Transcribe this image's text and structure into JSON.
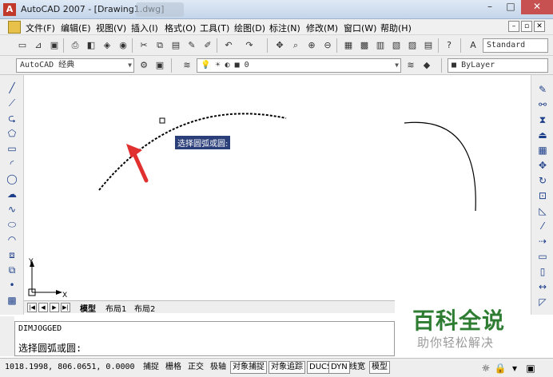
{
  "window": {
    "title": "AutoCAD 2007 - [Drawing1.dwg]",
    "controls": {
      "minimize": "–",
      "maximize": "□",
      "close": "✕"
    }
  },
  "menubar": {
    "items": [
      {
        "label": "文件(F)"
      },
      {
        "label": "编辑(E)"
      },
      {
        "label": "视图(V)"
      },
      {
        "label": "插入(I)"
      },
      {
        "label": "格式(O)"
      },
      {
        "label": "工具(T)"
      },
      {
        "label": "绘图(D)"
      },
      {
        "label": "标注(N)"
      },
      {
        "label": "修改(M)"
      },
      {
        "label": "窗口(W)"
      },
      {
        "label": "帮助(H)"
      }
    ],
    "mdi": {
      "minimize": "–",
      "restore": "▫",
      "close": "✕"
    }
  },
  "toolbar": {
    "text_style": "Standard",
    "workspace": "AutoCAD 经典",
    "layer": "0",
    "color": "ByLayer"
  },
  "canvas": {
    "tooltip": "选择圆弧或圆:",
    "ucs": {
      "x": "X",
      "y": "Y"
    }
  },
  "tabs": {
    "model": "模型",
    "layout1": "布局1",
    "layout2": "布局2"
  },
  "command": {
    "history": "DIMJOGGED",
    "prompt": "选择圆弧或圆:"
  },
  "statusbar": {
    "coords": "1018.1998, 806.0651, 0.0000",
    "toggles": [
      {
        "label": "捕捉",
        "on": false
      },
      {
        "label": "栅格",
        "on": false
      },
      {
        "label": "正交",
        "on": false
      },
      {
        "label": "极轴",
        "on": false
      },
      {
        "label": "对象捕捉",
        "on": true
      },
      {
        "label": "对象追踪",
        "on": true
      },
      {
        "label": "DUCS",
        "on": true
      },
      {
        "label": "DYN",
        "on": true
      },
      {
        "label": "线宽",
        "on": false
      },
      {
        "label": "模型",
        "on": true
      }
    ]
  },
  "watermark": {
    "title": "百科全说",
    "subtitle": "助你轻松解决"
  },
  "colors": {
    "arrow": "#e03030",
    "tooltip_bg": "#2a3f7a",
    "watermark": "#2e7d32"
  }
}
